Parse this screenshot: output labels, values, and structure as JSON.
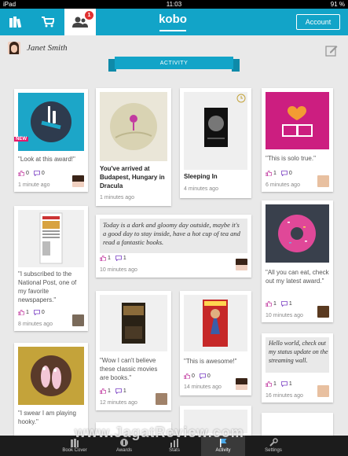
{
  "status": {
    "device": "iPad",
    "time": "11:03",
    "battery": "91 %"
  },
  "nav": {
    "activity_badge": "1",
    "logo": "kobo",
    "account_label": "Account"
  },
  "user": {
    "name": "Janet Smith"
  },
  "ribbon": "ACTIVITY",
  "cards": {
    "c1": {
      "tag": "NEW",
      "text": "\"Look at this award!\"",
      "likes": "0",
      "comments": "0",
      "time": "1 minute ago"
    },
    "c2": {
      "title": "You've arrived at Budapest, Hungary in Dracula",
      "time": "1 minutes ago"
    },
    "c3": {
      "title": "Sleeping In",
      "time": "4 minutes ago"
    },
    "c4": {
      "text": "\"This is solo true.\"",
      "likes": "1",
      "comments": "0",
      "time": "6 minutes ago"
    },
    "c5": {
      "text": "\"I subscribed to the National Post, one of my favorite newspapers.\"",
      "likes": "1",
      "comments": "0",
      "time": "8 minutes ago"
    },
    "c6": {
      "quote": "Today is a dark and gloomy day outside, maybe it's a good day to stay inside, have a hot cup of tea and read a fantastic books.",
      "likes": "1",
      "comments": "1",
      "time": "10 minutes ago"
    },
    "c7": {
      "text": "\"All you can eat, check out my latest award.\"",
      "likes": "1",
      "comments": "1",
      "time": "10 minutes ago"
    },
    "c8": {
      "text": "\"Wow I can't believe these classic movies are books.\"",
      "likes": "1",
      "comments": "1",
      "time": "12 minutes ago"
    },
    "c9": {
      "text": "\"This is awesome!\"",
      "likes": "0",
      "comments": "0",
      "time": "14 minutes ago"
    },
    "c10": {
      "quote": "Hello world, check out my status update on the streaming wall.",
      "likes": "1",
      "comments": "1",
      "time": "16 minutes ago"
    },
    "c11": {
      "text": "\"I swear I am playing hooky.\""
    }
  },
  "tabs": [
    "Book Cover",
    "Awards",
    "Stats",
    "Activity",
    "Settings"
  ],
  "watermark": "www.JagatReview.com",
  "colors": {
    "brand": "#12a4c8",
    "like": "#c23ba0",
    "comment": "#7a3fc4"
  }
}
